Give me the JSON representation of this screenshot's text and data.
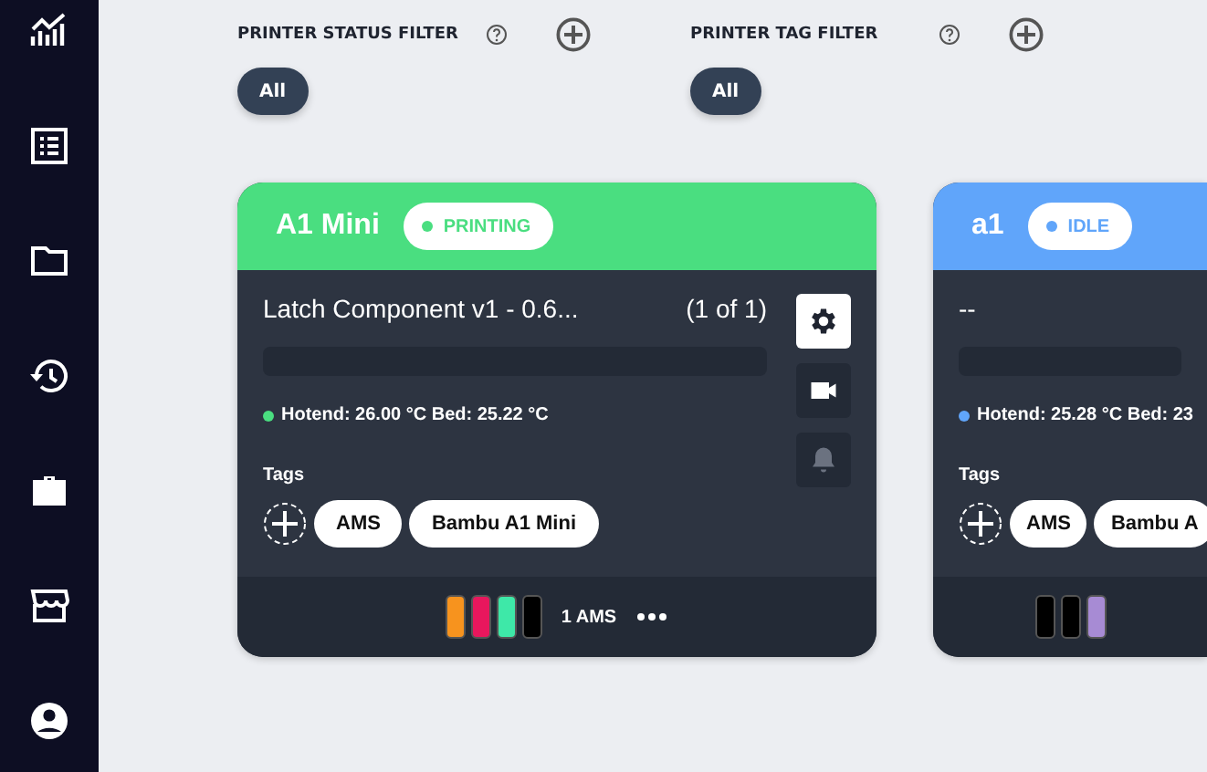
{
  "filters": [
    {
      "label": "PRINTER STATUS FILTER",
      "chips": [
        {
          "label": "All",
          "selected": true
        }
      ]
    },
    {
      "label": "PRINTER TAG FILTER",
      "chips": [
        {
          "label": "All",
          "selected": true
        }
      ]
    }
  ],
  "printers": [
    {
      "name": "A1 Mini",
      "status": "PRINTING",
      "color": "#4ade80",
      "job": "Latch Component v1 - 0.6...",
      "count": "(1 of 1)",
      "level": 0,
      "temps": "Hotend: 26.00 °C Bed: 25.22 °C",
      "tags_label": "Tags",
      "tags": [
        "AMS",
        "Bambu A1 Mini"
      ],
      "filaments": [
        {
          "color": "#f7931e"
        },
        {
          "color": "#e8175d"
        },
        {
          "color": "#3ee8a8"
        },
        {
          "color": "#000000"
        }
      ],
      "ams": "1 AMS",
      "actions": [
        {
          "kind": "settings",
          "selected": true,
          "disabled": false
        },
        {
          "kind": "camera",
          "selected": false,
          "disabled": false
        },
        {
          "kind": "bell",
          "selected": false,
          "disabled": true
        }
      ]
    },
    {
      "name": "a1",
      "status": "IDLE",
      "color": "#60a5fa",
      "job": "--",
      "level": 0,
      "temps": "Hotend: 25.28 °C Bed: 23",
      "tags_label": "Tags",
      "tags": [
        "AMS",
        "Bambu A"
      ],
      "filaments": [
        {
          "color": "#000000"
        },
        {
          "color": "#000000"
        },
        {
          "color": "#a78bd4"
        }
      ]
    }
  ]
}
